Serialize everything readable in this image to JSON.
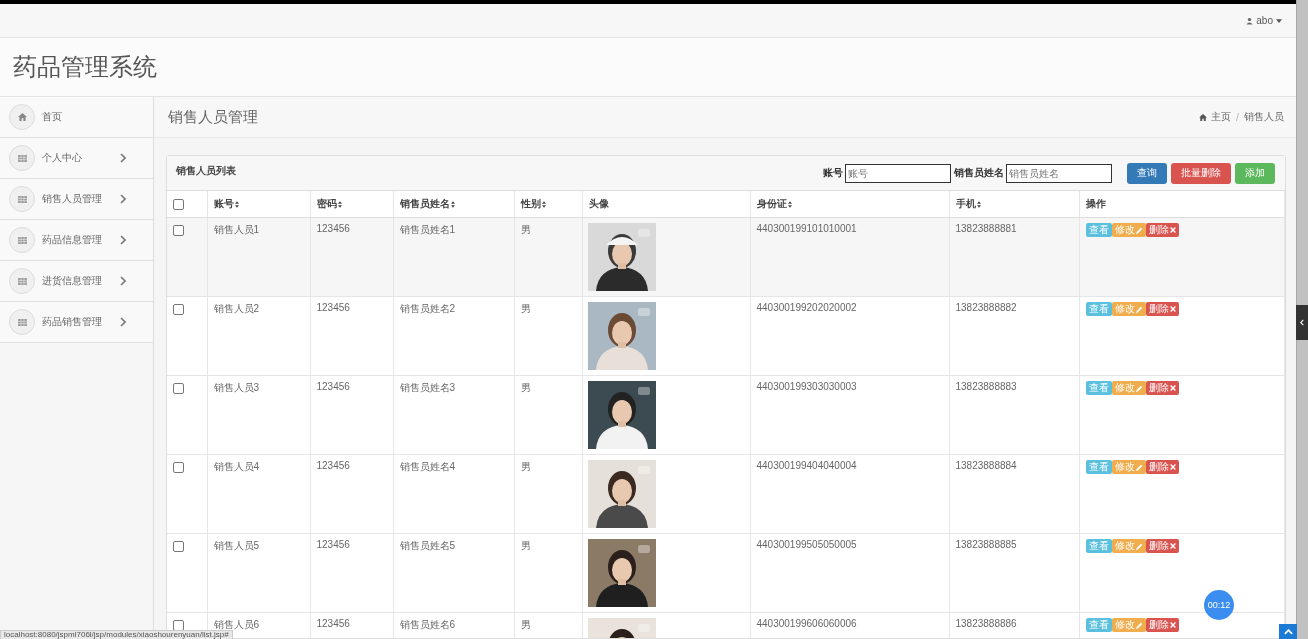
{
  "top_bar": {
    "user": "abo"
  },
  "app_title": "药品管理系统",
  "sidebar": {
    "items": [
      {
        "label": "首页",
        "kind": "home",
        "has_submenu": false
      },
      {
        "label": "个人中心",
        "kind": "menu",
        "has_submenu": true
      },
      {
        "label": "销售人员管理",
        "kind": "menu",
        "has_submenu": true
      },
      {
        "label": "药品信息管理",
        "kind": "menu",
        "has_submenu": true
      },
      {
        "label": "进货信息管理",
        "kind": "menu",
        "has_submenu": true
      },
      {
        "label": "药品销售管理",
        "kind": "menu",
        "has_submenu": true
      }
    ]
  },
  "page_title": "销售人员管理",
  "breadcrumb": [
    "主页",
    "销售人员"
  ],
  "panel": {
    "title": "销售人员列表",
    "search": [
      {
        "label": "账号",
        "placeholder": "账号"
      },
      {
        "label": "销售员姓名",
        "placeholder": "销售员姓名"
      }
    ],
    "buttons": [
      {
        "label": "查询",
        "kind": "primary"
      },
      {
        "label": "批量删除",
        "kind": "danger"
      },
      {
        "label": "添加",
        "kind": "success"
      }
    ]
  },
  "table": {
    "select_all": {
      "checked": false
    },
    "columns": [
      {
        "label": "账号",
        "sortable": true
      },
      {
        "label": "密码",
        "sortable": true
      },
      {
        "label": "销售员姓名",
        "sortable": true
      },
      {
        "label": "性别",
        "sortable": true
      },
      {
        "label": "头像",
        "sortable": false
      },
      {
        "label": "身份证",
        "sortable": true
      },
      {
        "label": "手机",
        "sortable": true
      },
      {
        "label": "操作",
        "sortable": false
      }
    ],
    "rows": [
      {
        "checked": false,
        "account": "销售人员1",
        "password": "123456",
        "name": "销售员姓名1",
        "gender": "男",
        "id_card": "440300199101010001",
        "phone": "13823888881",
        "actions": [
          "查看",
          "修改",
          "删除"
        ]
      },
      {
        "checked": false,
        "account": "销售人员2",
        "password": "123456",
        "name": "销售员姓名2",
        "gender": "男",
        "id_card": "440300199202020002",
        "phone": "13823888882",
        "actions": [
          "查看",
          "修改",
          "删除"
        ]
      },
      {
        "checked": false,
        "account": "销售人员3",
        "password": "123456",
        "name": "销售员姓名3",
        "gender": "男",
        "id_card": "440300199303030003",
        "phone": "13823888883",
        "actions": [
          "查看",
          "修改",
          "删除"
        ]
      },
      {
        "checked": false,
        "account": "销售人员4",
        "password": "123456",
        "name": "销售员姓名4",
        "gender": "男",
        "id_card": "440300199404040004",
        "phone": "13823888884",
        "actions": [
          "查看",
          "修改",
          "删除"
        ]
      },
      {
        "checked": false,
        "account": "销售人员5",
        "password": "123456",
        "name": "销售员姓名5",
        "gender": "男",
        "id_card": "440300199505050005",
        "phone": "13823888885",
        "actions": [
          "查看",
          "修改",
          "删除"
        ]
      },
      {
        "checked": false,
        "account": "销售人员6",
        "password": "123456",
        "name": "销售员姓名6",
        "gender": "男",
        "id_card": "440300199606060006",
        "phone": "13823888886",
        "actions": [
          "查看",
          "修改",
          "删除"
        ]
      }
    ]
  },
  "status_url": "localhost:8080/jspml706l/jsp/modules/xiaoshourenyuan/list.jsp#",
  "timer": "00:12"
}
